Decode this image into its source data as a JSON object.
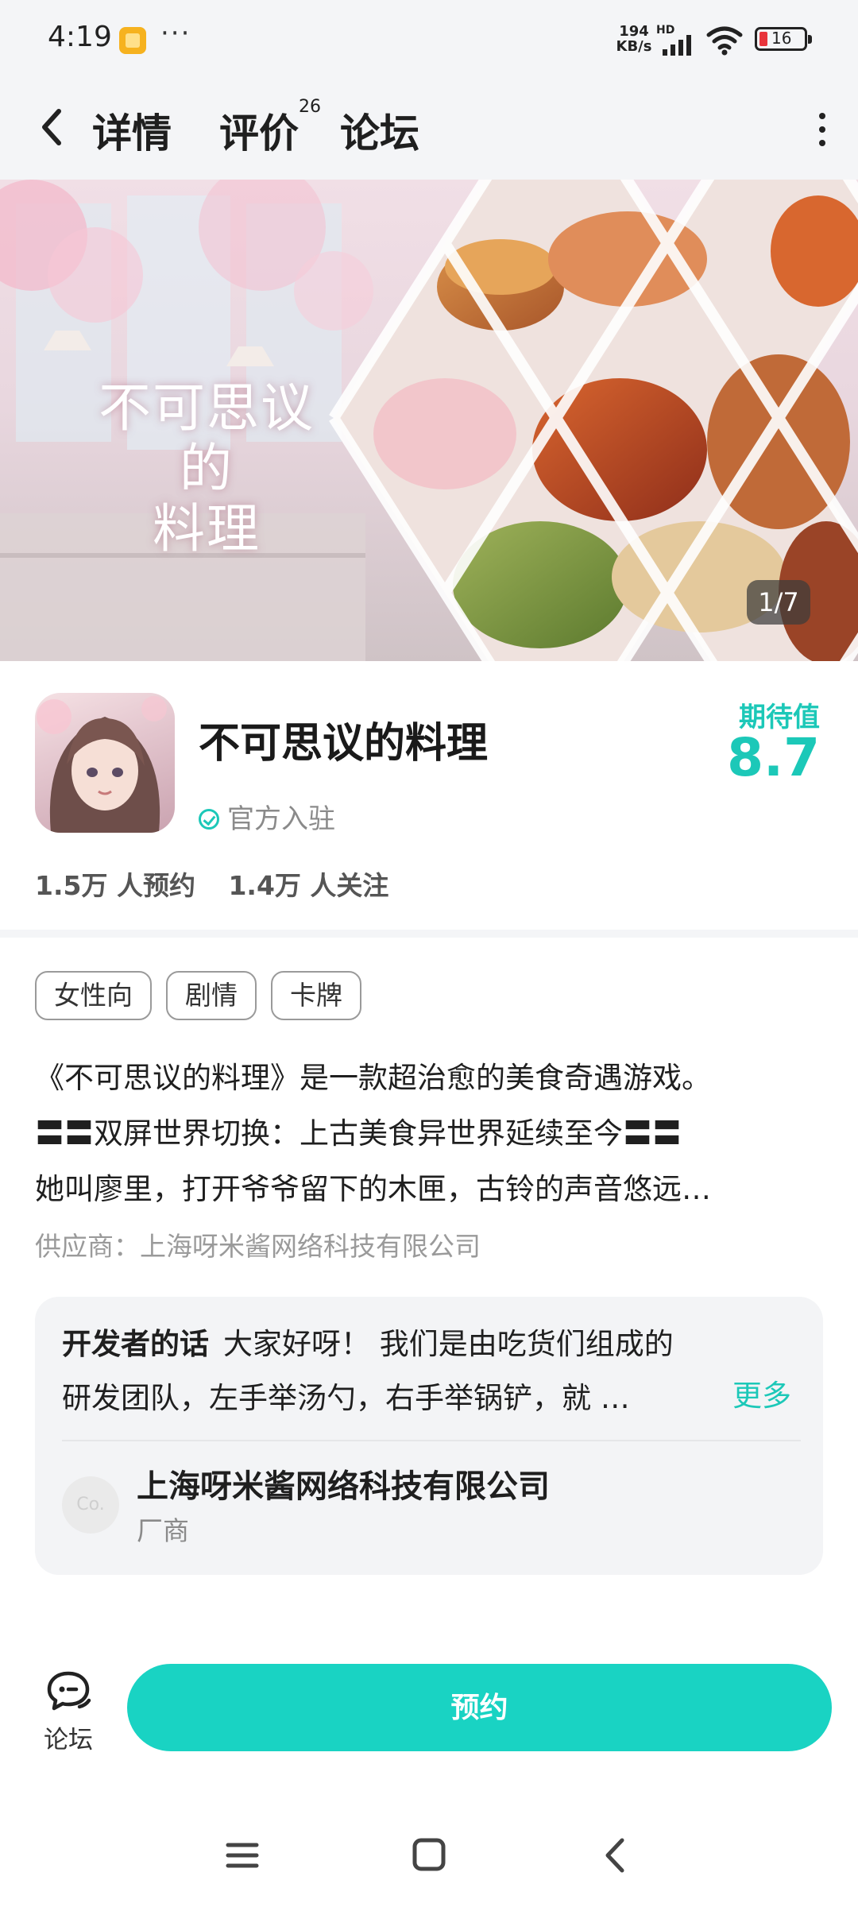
{
  "status_bar": {
    "time": "4:19",
    "more": "···",
    "net_speed_value": "194",
    "net_speed_unit": "KB/s",
    "hd_label": "HD",
    "battery": "16",
    "icons": [
      "app-notification-icon",
      "signal-icon",
      "wifi-icon",
      "battery-icon"
    ]
  },
  "header": {
    "back_icon": "chevron-left-icon",
    "tabs": [
      {
        "label": "详情",
        "active": true
      },
      {
        "label": "评价",
        "count": "26"
      },
      {
        "label": "论坛"
      }
    ],
    "menu_icon": "more-vertical-icon"
  },
  "banner": {
    "title_lines": [
      "不可思议",
      "的",
      "料理"
    ],
    "counter": "1/7"
  },
  "app": {
    "name": "不可思议的料理",
    "verified_label": "官方入驻",
    "expect_label": "期待值",
    "expect_score": "8.7",
    "stats": {
      "reservations": "1.5万 人预约",
      "followers": "1.4万 人关注"
    }
  },
  "tags": [
    "女性向",
    "剧情",
    "卡牌"
  ],
  "description": {
    "lines": [
      "《不可思议的料理》是一款超治愈的美食奇遇游戏。",
      "〓〓双屏世界切换：上古美食异世界延续至今〓〓",
      "她叫廖里，打开爷爷留下的木匣，古铃的声音悠远…"
    ],
    "supplier": "供应商：上海呀米酱网络科技有限公司"
  },
  "developer": {
    "label": "开发者的话",
    "text_line1": "大家好呀！ 我们是由吃货们组成的",
    "text_line2": "研发团队，左手举汤勺，右手举锅铲，就 …",
    "more": "更多",
    "avatar_text": "Co.",
    "company": "上海呀米酱网络科技有限公司",
    "role": "厂商"
  },
  "bottom_bar": {
    "forum_label": "论坛",
    "forum_icon": "chat-bubble-icon",
    "reserve_label": "预约"
  },
  "colors": {
    "accent": "#1cc8b8",
    "button": "#19d3c3",
    "header_bg": "#f4f5f7"
  }
}
